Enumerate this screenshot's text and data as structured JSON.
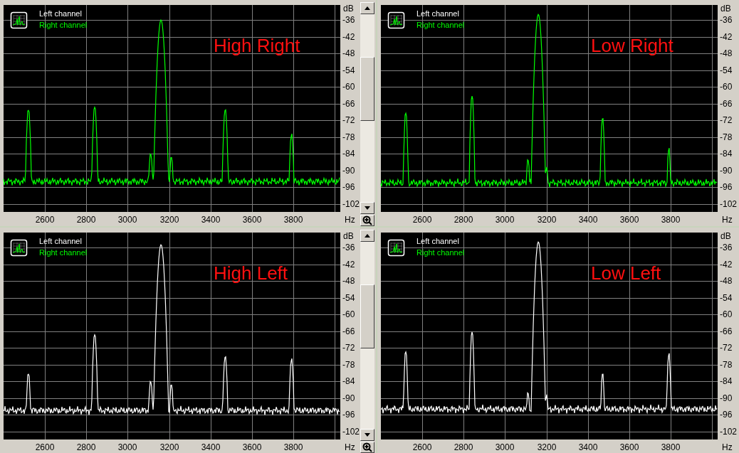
{
  "panels": [
    {
      "title": "High Right",
      "legend": [
        {
          "label": "Left channel",
          "color": "#ffffff"
        },
        {
          "label": "Right channel",
          "color": "#00ff00"
        }
      ],
      "right_channel_plotted": true,
      "y_unit": "dB",
      "y_tick_labels": [
        "-36",
        "-42",
        "-48",
        "-54",
        "-60",
        "-66",
        "-72",
        "-78",
        "-84",
        "-90",
        "-96",
        "-102"
      ],
      "x_tick_labels": [
        "2600",
        "2800",
        "3000",
        "3200",
        "3400",
        "3600",
        "3800"
      ],
      "x_unit": "Hz",
      "scrollbar": true
    },
    {
      "title": "Low Right",
      "legend": [
        {
          "label": "Left channel",
          "color": "#ffffff"
        },
        {
          "label": "Right channel",
          "color": "#00ff00"
        }
      ],
      "right_channel_plotted": true,
      "y_unit": "dB",
      "y_tick_labels": [
        "-36",
        "-42",
        "-48",
        "-54",
        "-60",
        "-66",
        "-72",
        "-78",
        "-84",
        "-90",
        "-96",
        "-102"
      ],
      "x_tick_labels": [
        "2600",
        "2800",
        "3000",
        "3200",
        "3400",
        "3600",
        "3800"
      ],
      "x_unit": "Hz",
      "scrollbar": false
    },
    {
      "title": "High Left",
      "legend": [
        {
          "label": "Left channel",
          "color": "#ffffff"
        },
        {
          "label": "Right channel",
          "color": "#00ff00"
        }
      ],
      "right_channel_plotted": false,
      "y_unit": "dB",
      "y_tick_labels": [
        "-36",
        "-42",
        "-48",
        "-54",
        "-60",
        "-66",
        "-72",
        "-78",
        "-84",
        "-90",
        "-96",
        "-102"
      ],
      "x_tick_labels": [
        "2600",
        "2800",
        "3000",
        "3200",
        "3400",
        "3600",
        "3800"
      ],
      "x_unit": "Hz",
      "scrollbar": true
    },
    {
      "title": "Low Left",
      "legend": [
        {
          "label": "Left channel",
          "color": "#ffffff"
        },
        {
          "label": "Right channel",
          "color": "#00ff00"
        }
      ],
      "right_channel_plotted": false,
      "y_unit": "dB",
      "y_tick_labels": [
        "-36",
        "-42",
        "-48",
        "-54",
        "-60",
        "-66",
        "-72",
        "-78",
        "-84",
        "-90",
        "-96",
        "-102"
      ],
      "x_tick_labels": [
        "2600",
        "2800",
        "3000",
        "3200",
        "3400",
        "3600",
        "3800"
      ],
      "x_unit": "Hz",
      "scrollbar": false
    }
  ]
}
